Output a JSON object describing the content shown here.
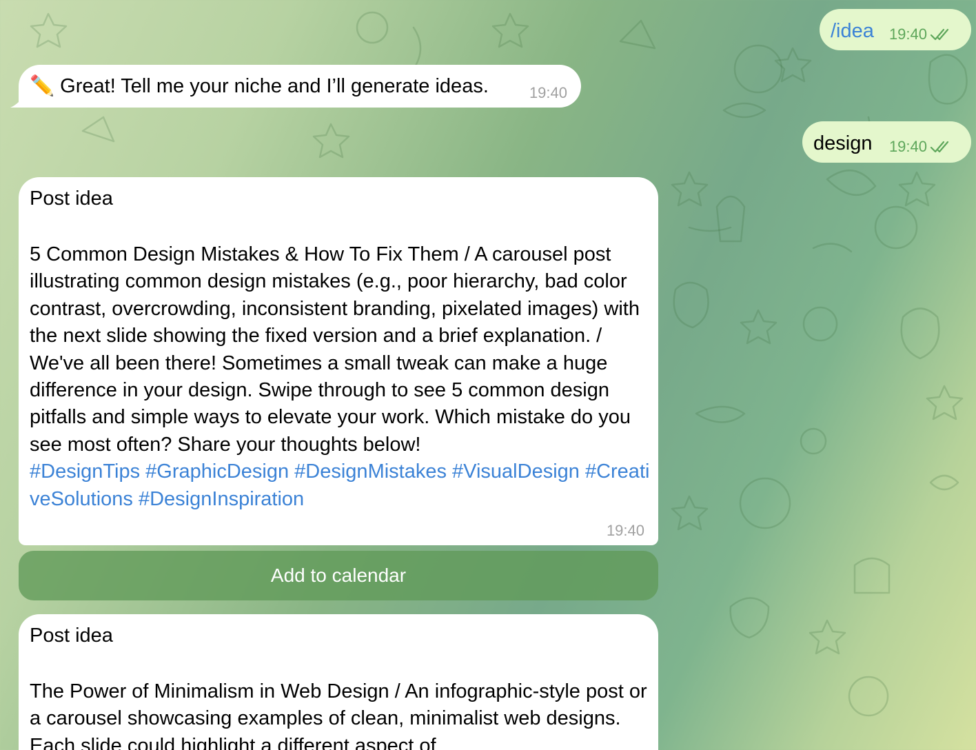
{
  "messages": {
    "cmd_idea": {
      "text": "/idea",
      "time": "19:40",
      "status_icon": "double-check-icon"
    },
    "bot_reply": {
      "emoji": "✏️",
      "text": "Great! Tell me your niche and I’ll generate ideas.",
      "time": "19:40"
    },
    "user_niche": {
      "text": "design",
      "time": "19:40",
      "status_icon": "double-check-icon"
    },
    "post1": {
      "title": "Post idea",
      "body": "5 Common Design Mistakes & How To Fix Them / A carousel post illustrating common design mistakes (e.g., poor hierarchy, bad color contrast, overcrowding, inconsistent branding, pixelated images) with the next slide showing the fixed version and a brief explanation. / We've all been there! Sometimes a small tweak can make a huge difference in your design. Swipe through to see 5 common design pitfalls and simple ways to elevate your work. Which mistake do you see most often? Share your thoughts below!",
      "hashtags": "#DesignTips #GraphicDesign #DesignMistakes #VisualDesign #CreativeSolutions #DesignInspiration",
      "time": "19:40"
    },
    "calendar_button": {
      "label": "Add to calendar"
    },
    "post2": {
      "title": "Post idea",
      "body": "The Power of Minimalism in Web Design / An infographic-style post or a carousel showcasing examples of clean, minimalist web designs. Each slide could highlight a different aspect of"
    }
  },
  "colors": {
    "outgoing_bubble": "#e4f7cc",
    "incoming_bubble": "#ffffff",
    "link_blue": "#3b82d6",
    "outgoing_time": "#5da65a",
    "incoming_time": "#a0a0a0",
    "button_green": "#609a58"
  }
}
